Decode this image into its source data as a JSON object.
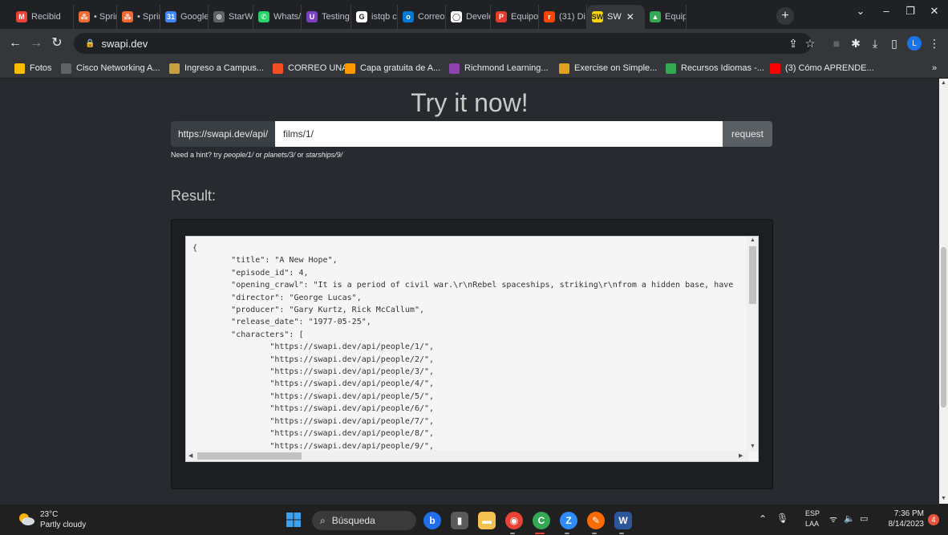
{
  "browser": {
    "tabs": [
      {
        "title": "Recibid",
        "fav_color": "#ea4335",
        "fav_char": "M"
      },
      {
        "title": "• Sprin",
        "fav_color": "#f06a35",
        "fav_char": "⁂"
      },
      {
        "title": "• Sprin",
        "fav_color": "#f06a35",
        "fav_char": "⁂"
      },
      {
        "title": "Google",
        "fav_color": "#4285f4",
        "fav_char": "31"
      },
      {
        "title": "StarWa",
        "fav_color": "#5f6368",
        "fav_char": "⊙"
      },
      {
        "title": "Whats/",
        "fav_color": "#25d366",
        "fav_char": "✆"
      },
      {
        "title": "Testing",
        "fav_color": "#7b3fbf",
        "fav_char": "U"
      },
      {
        "title": "istqb c",
        "fav_color": "#ffffff",
        "fav_char": "G"
      },
      {
        "title": "Correo",
        "fav_color": "#0078d4",
        "fav_char": "o"
      },
      {
        "title": "Develo",
        "fav_color": "#ffffff",
        "fav_char": "◯"
      },
      {
        "title": "Equipo",
        "fav_color": "#e33b2e",
        "fav_char": "P"
      },
      {
        "title": "(31) Di",
        "fav_color": "#ff4500",
        "fav_char": "r"
      },
      {
        "title": "SW",
        "fav_color": "#ffd700",
        "fav_char": "SW",
        "active": true
      },
      {
        "title": "Equipo",
        "fav_color": "#34a853",
        "fav_char": "▲"
      }
    ],
    "address": "swapi.dev",
    "bookmarks": [
      {
        "label": "Fotos",
        "color": "#fbbc04"
      },
      {
        "label": "Cisco Networking A...",
        "color": "#5f6368"
      },
      {
        "label": "Ingreso a Campus...",
        "color": "#c8a040"
      },
      {
        "label": "CORREO UNAD",
        "color": "#f25022"
      },
      {
        "label": "Capa gratuita de A...",
        "color": "#ff9900"
      },
      {
        "label": "Richmond Learning...",
        "color": "#8e44ad"
      },
      {
        "label": "Exercise on Simple...",
        "color": "#e0a020"
      },
      {
        "label": "Recursos Idiomas -...",
        "color": "#34a853"
      },
      {
        "label": "(3) Cómo APRENDE...",
        "color": "#ff0000"
      }
    ],
    "profile_initial": "L"
  },
  "page": {
    "heading": "Try it now!",
    "url_prefix": "https://swapi.dev/api/",
    "url_value": "films/1/",
    "request_label": "request",
    "hint_prefix": "Need a hint? try ",
    "hint_ex1": "people/1/",
    "hint_or1": " or ",
    "hint_ex2": "planets/3/",
    "hint_or2": " or ",
    "hint_ex3": "starships/9/",
    "result_label": "Result:",
    "result_json": "{\n\t\"title\": \"A New Hope\",\n\t\"episode_id\": 4,\n\t\"opening_crawl\": \"It is a period of civil war.\\r\\nRebel spaceships, striking\\r\\nfrom a hidden base, have\n\t\"director\": \"George Lucas\",\n\t\"producer\": \"Gary Kurtz, Rick McCallum\",\n\t\"release_date\": \"1977-05-25\",\n\t\"characters\": [\n\t\t\"https://swapi.dev/api/people/1/\",\n\t\t\"https://swapi.dev/api/people/2/\",\n\t\t\"https://swapi.dev/api/people/3/\",\n\t\t\"https://swapi.dev/api/people/4/\",\n\t\t\"https://swapi.dev/api/people/5/\",\n\t\t\"https://swapi.dev/api/people/6/\",\n\t\t\"https://swapi.dev/api/people/7/\",\n\t\t\"https://swapi.dev/api/people/8/\",\n\t\t\"https://swapi.dev/api/people/9/\","
  },
  "taskbar": {
    "weather_temp": "23°C",
    "weather_desc": "Partly cloudy",
    "search_placeholder": "Búsqueda",
    "lang_top": "ESP",
    "lang_bottom": "LAA",
    "time": "7:36 PM",
    "date": "8/14/2023",
    "notif_count": "4"
  }
}
